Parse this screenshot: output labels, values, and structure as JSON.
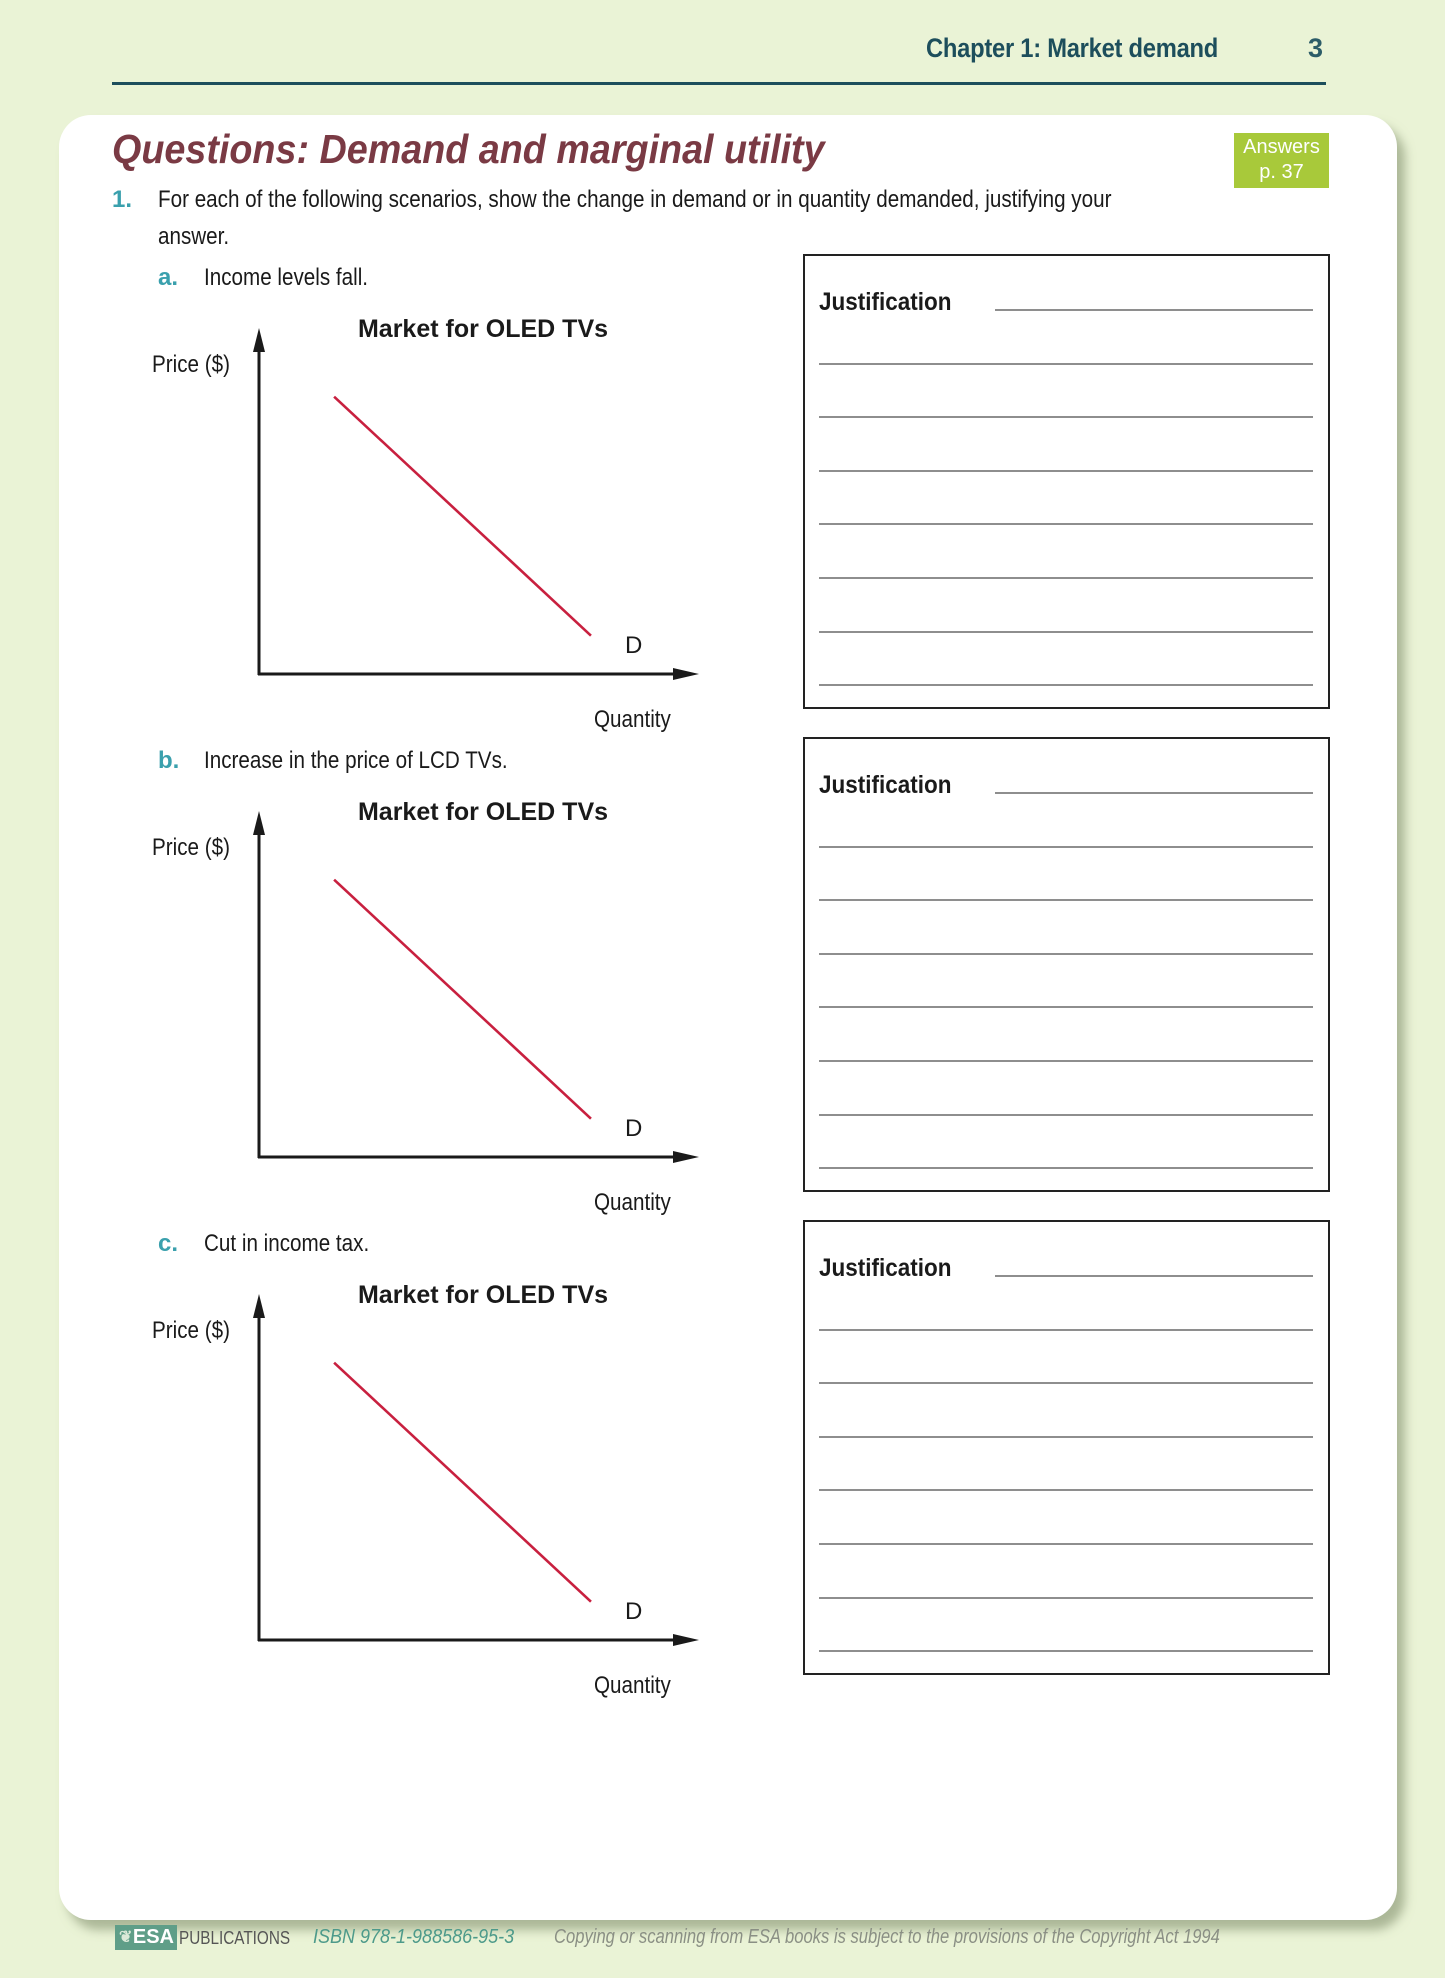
{
  "header": {
    "chapter": "Chapter 1: Market demand",
    "page_number": "3"
  },
  "title": "Questions: Demand and marginal utility",
  "answers_badge": {
    "line1": "Answers",
    "line2": "p. 37",
    "color": "#a8c93a"
  },
  "question": {
    "number": "1.",
    "text_line1": "For each of the following scenarios, show the change in demand or in quantity demanded, justifying your",
    "text_line2": "answer."
  },
  "parts": [
    {
      "letter": "a.",
      "scenario": "Income levels fall.",
      "justification_label": "Justification",
      "answer_lines": 8
    },
    {
      "letter": "b.",
      "scenario": "Increase in the price of LCD TVs.",
      "justification_label": "Justification",
      "answer_lines": 8
    },
    {
      "letter": "c.",
      "scenario": "Cut in income tax.",
      "justification_label": "Justification",
      "answer_lines": 8
    }
  ],
  "chart_data": [
    {
      "type": "line",
      "title": "Market for OLED TVs",
      "xlabel": "Quantity",
      "ylabel": "Price ($)",
      "series": [
        {
          "name": "D",
          "color": "#c8203f",
          "points": [
            [
              0.2,
              0.8
            ],
            [
              0.85,
              0.12
            ]
          ]
        }
      ],
      "xlim": [
        0,
        1
      ],
      "ylim": [
        0,
        1
      ],
      "grid": false,
      "ticks": "none"
    },
    {
      "type": "line",
      "title": "Market for OLED TVs",
      "xlabel": "Quantity",
      "ylabel": "Price ($)",
      "series": [
        {
          "name": "D",
          "color": "#c8203f",
          "points": [
            [
              0.2,
              0.8
            ],
            [
              0.85,
              0.12
            ]
          ]
        }
      ],
      "xlim": [
        0,
        1
      ],
      "ylim": [
        0,
        1
      ],
      "grid": false,
      "ticks": "none"
    },
    {
      "type": "line",
      "title": "Market for OLED TVs",
      "xlabel": "Quantity",
      "ylabel": "Price ($)",
      "series": [
        {
          "name": "D",
          "color": "#c8203f",
          "points": [
            [
              0.2,
              0.8
            ],
            [
              0.85,
              0.12
            ]
          ]
        }
      ],
      "xlim": [
        0,
        1
      ],
      "ylim": [
        0,
        1
      ],
      "grid": false,
      "ticks": "none"
    }
  ],
  "footer": {
    "logo": "ESA",
    "publisher": "PUBLICATIONS",
    "isbn": "ISBN 978-1-988586-95-3",
    "copyright": "Copying or scanning from ESA books is subject to the provisions of the Copyright Act 1994"
  }
}
